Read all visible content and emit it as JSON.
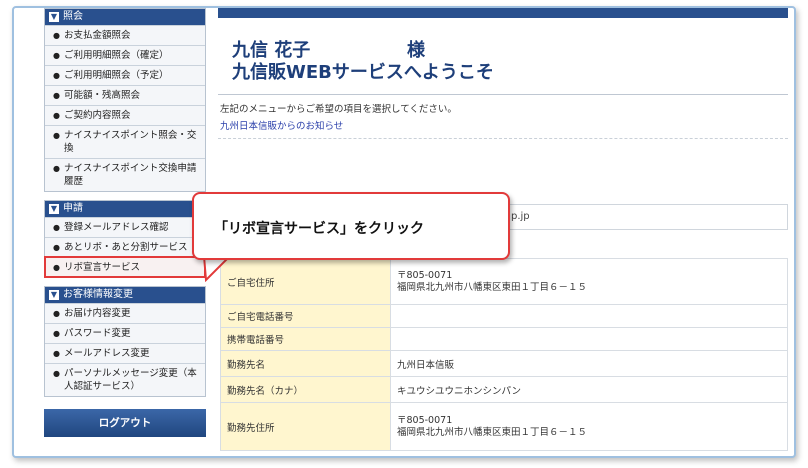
{
  "sidebar": {
    "sections": [
      {
        "title": "照会",
        "items": [
          {
            "label": "お支払金額照会"
          },
          {
            "label": "ご利用明細照会（確定）"
          },
          {
            "label": "ご利用明細照会（予定）"
          },
          {
            "label": "可能額・残高照会"
          },
          {
            "label": "ご契約内容照会"
          },
          {
            "label": "ナイスナイスポイント照会・交換"
          },
          {
            "label": "ナイスナイスポイント交換申請履歴"
          }
        ]
      },
      {
        "title": "申請",
        "items": [
          {
            "label": "登録メールアドレス確認"
          },
          {
            "label": "あとリボ・あと分割サービス"
          },
          {
            "label": "リボ宣言サービス"
          }
        ]
      },
      {
        "title": "お客様情報変更",
        "items": [
          {
            "label": "お届け内容変更"
          },
          {
            "label": "パスワード変更"
          },
          {
            "label": "メールアドレス変更"
          },
          {
            "label": "パーソナルメッセージ変更（本人認証サービス）"
          }
        ]
      }
    ],
    "logout_label": "ログアウト"
  },
  "main": {
    "customer_name": "九信 花子",
    "honorific": "様",
    "welcome": "九信販WEBサービスへようこそ",
    "instruction": "左記のメニューからご希望の項目を選択してください。",
    "notice_link": "九州日本信販からのお知らせ",
    "email_partial": "p.jp",
    "table": [
      {
        "key": "ご自宅住所",
        "value_lines": [
          "〒805-0071",
          "福岡県北九州市八幡東区東田１丁目６－１５"
        ]
      },
      {
        "key": "ご自宅電話番号",
        "value_lines": [
          ""
        ]
      },
      {
        "key": "携帯電話番号",
        "value_lines": [
          ""
        ]
      },
      {
        "key": "勤務先名",
        "value_lines": [
          "九州日本信販"
        ]
      },
      {
        "key": "勤務先名（カナ）",
        "value_lines": [
          "キユウシユウニホンシンパン"
        ]
      },
      {
        "key": "勤務先住所",
        "value_lines": [
          "〒805-0071",
          "福岡県北九州市八幡東区東田１丁目６－１５"
        ]
      }
    ]
  },
  "callout": {
    "text": "「リボ宣言サービス」をクリック"
  },
  "colors": {
    "header_blue": "#29508e",
    "highlight_red": "#e23a3a",
    "key_cell_yellow": "#fff6cf"
  },
  "icons": {
    "section_toggle": "checkbox-icon",
    "item_bullet": "bullet-icon"
  }
}
